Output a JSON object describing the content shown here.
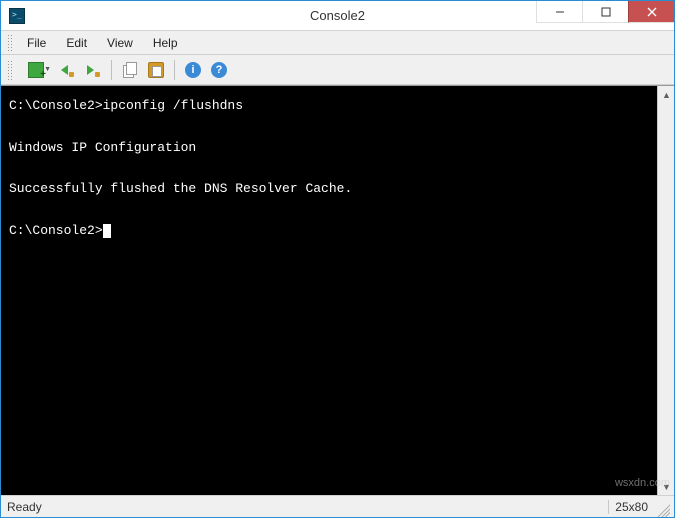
{
  "window": {
    "title": "Console2"
  },
  "menu": {
    "file": "File",
    "edit": "Edit",
    "view": "View",
    "help": "Help"
  },
  "toolbar": {
    "icons": {
      "new_tab": "new-tab-icon",
      "prev": "switch-left-icon",
      "next": "switch-right-icon",
      "copy": "copy-icon",
      "paste": "paste-icon",
      "about": "info-icon",
      "help": "help-icon"
    }
  },
  "terminal": {
    "lines": [
      "C:\\Console2>ipconfig /flushdns",
      "",
      "Windows IP Configuration",
      "",
      "Successfully flushed the DNS Resolver Cache.",
      "",
      "C:\\Console2>"
    ],
    "prompt": "C:\\Console2>",
    "command": "ipconfig /flushdns"
  },
  "status": {
    "left": "Ready",
    "right": "25x80"
  },
  "watermark": "wsxdn.com"
}
